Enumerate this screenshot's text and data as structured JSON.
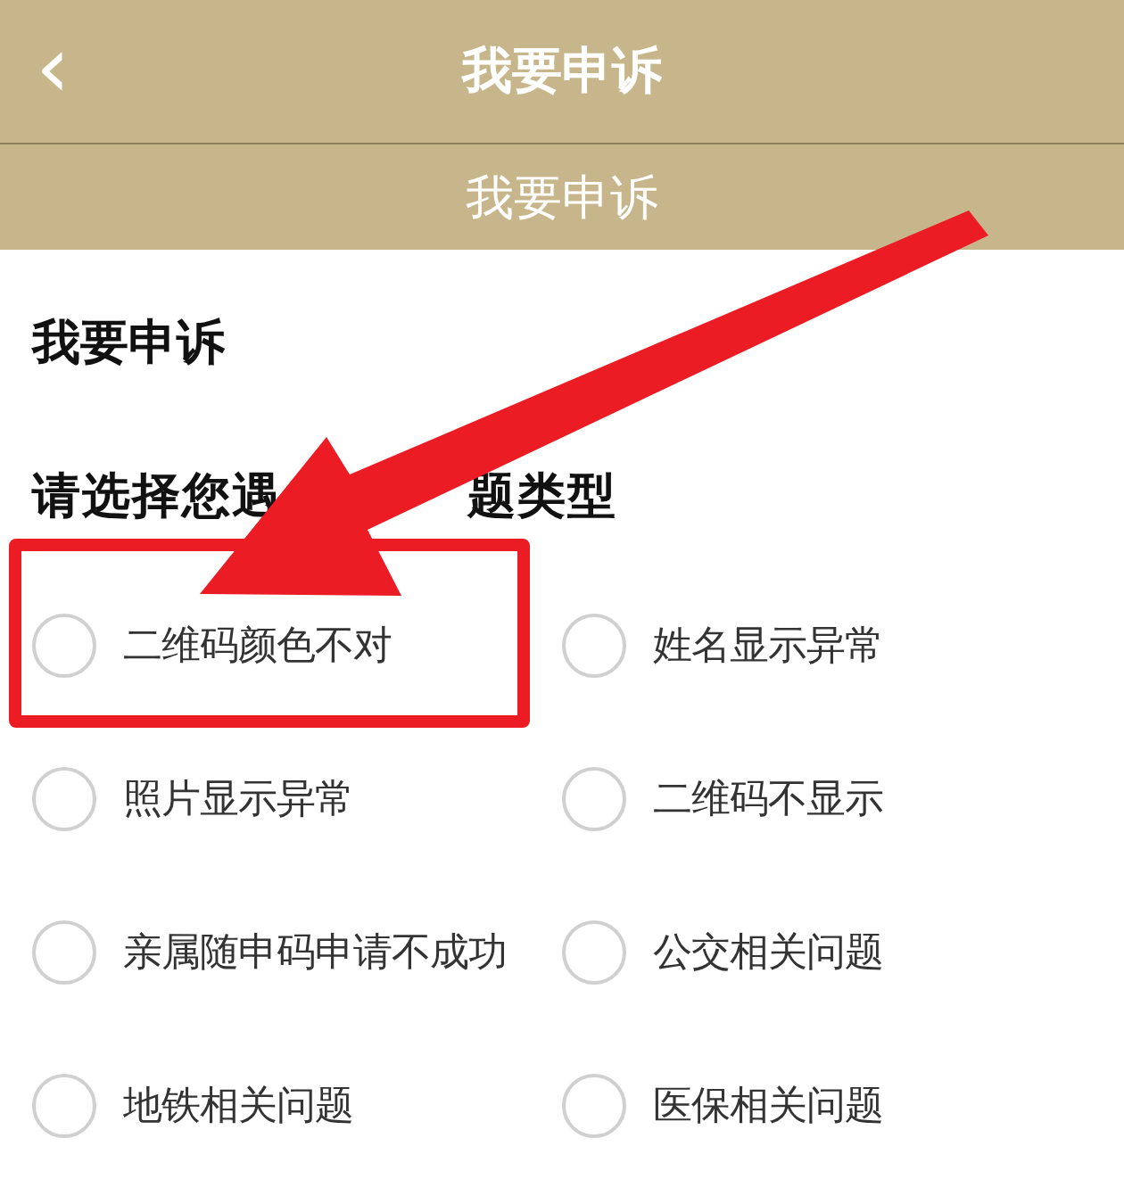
{
  "nav_bar": {
    "back_glyph": "‹",
    "title": "我要申诉"
  },
  "sub_header": {
    "title": "我要申诉"
  },
  "section_title": "我要申诉",
  "question_parts": [
    "请选择您遇",
    "题类型"
  ],
  "options": [
    {
      "label": "二维码颜色不对",
      "selected": false
    },
    {
      "label": "姓名显示异常",
      "selected": false
    },
    {
      "label": "照片显示异常",
      "selected": false
    },
    {
      "label": "二维码不显示",
      "selected": false
    },
    {
      "label": "亲属随申码申请不成功",
      "selected": false
    },
    {
      "label": "公交相关问题",
      "selected": false
    },
    {
      "label": "地铁相关问题",
      "selected": false
    },
    {
      "label": "医保相关问题",
      "selected": false
    }
  ]
}
